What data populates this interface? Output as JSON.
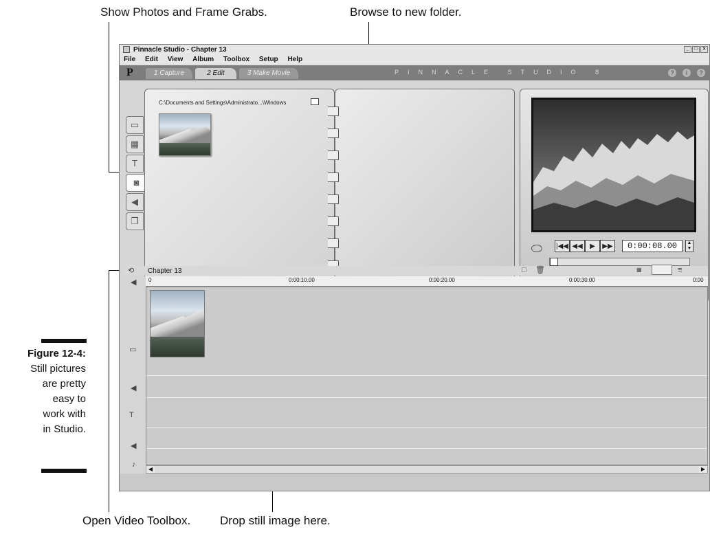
{
  "callouts": {
    "show_photos": "Show Photos and Frame Grabs.",
    "browse_folder": "Browse to new folder.",
    "open_video_toolbox": "Open Video Toolbox.",
    "drop_still": "Drop still image here."
  },
  "figure": {
    "label": "Figure 12-4:",
    "lines": [
      "Still pictures",
      "are pretty",
      "easy to",
      "work with",
      "in Studio."
    ]
  },
  "window": {
    "title": "Pinnacle Studio - Chapter 13",
    "menu": [
      "File",
      "Edit",
      "View",
      "Album",
      "Toolbox",
      "Setup",
      "Help"
    ],
    "tabs": [
      "1 Capture",
      "2 Edit",
      "3 Make Movie"
    ],
    "brand": "PINNACLE STUDIO 8"
  },
  "album": {
    "folder_path": "C:\\Documents and Settings\\Administrato...\\Windows"
  },
  "player": {
    "timecode": "0:00:08.00"
  },
  "timeline": {
    "title": "Chapter 13",
    "ruler": [
      "0",
      "0:00:10.00",
      "0:00:20.00",
      "0:00:30.00",
      "0:00"
    ]
  }
}
